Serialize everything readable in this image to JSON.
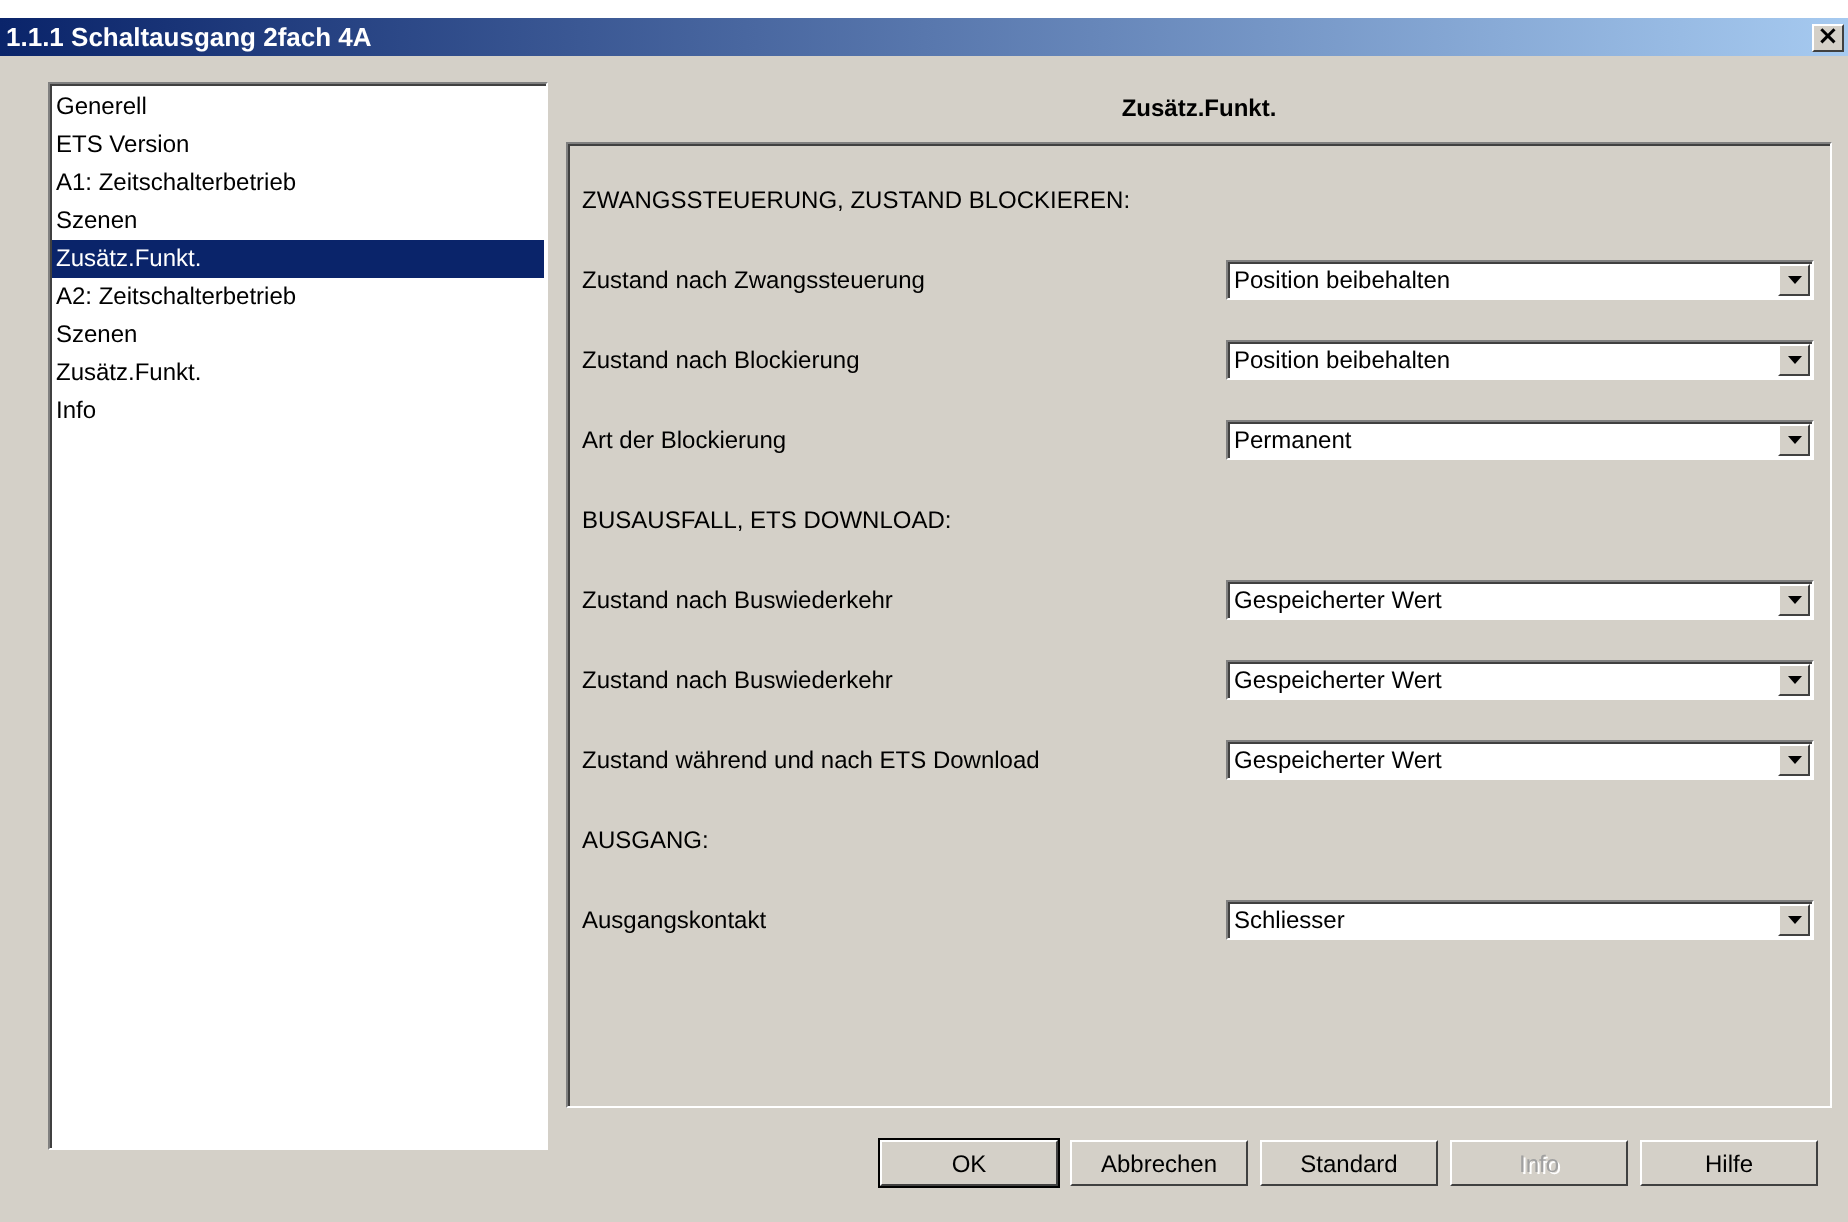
{
  "window": {
    "title": "1.1.1 Schaltausgang 2fach 4A",
    "close": "×"
  },
  "sidebar": {
    "items": [
      {
        "label": "Generell",
        "selected": false
      },
      {
        "label": "ETS Version",
        "selected": false
      },
      {
        "label": "A1: Zeitschalterbetrieb",
        "selected": false
      },
      {
        "label": "Szenen",
        "selected": false
      },
      {
        "label": "Zusätz.Funkt.",
        "selected": true
      },
      {
        "label": "A2: Zeitschalterbetrieb",
        "selected": false
      },
      {
        "label": "Szenen",
        "selected": false
      },
      {
        "label": "Zusätz.Funkt.",
        "selected": false
      },
      {
        "label": "Info",
        "selected": false
      }
    ]
  },
  "panel": {
    "title": "Zusätz.Funkt.",
    "items": [
      {
        "kind": "section",
        "label": "ZWANGSSTEUERUNG, ZUSTAND BLOCKIEREN:"
      },
      {
        "kind": "select",
        "label": "Zustand nach Zwangssteuerung",
        "value": "Position beibehalten"
      },
      {
        "kind": "select",
        "label": "Zustand nach Blockierung",
        "value": "Position beibehalten"
      },
      {
        "kind": "select",
        "label": "Art der Blockierung",
        "value": "Permanent"
      },
      {
        "kind": "section",
        "label": "BUSAUSFALL, ETS DOWNLOAD:"
      },
      {
        "kind": "select",
        "label": "Zustand nach Buswiederkehr",
        "value": "Gespeicherter Wert"
      },
      {
        "kind": "select",
        "label": "Zustand nach Buswiederkehr",
        "value": "Gespeicherter Wert"
      },
      {
        "kind": "select",
        "label": "Zustand während und nach ETS Download",
        "value": "Gespeicherter Wert"
      },
      {
        "kind": "section",
        "label": "AUSGANG:"
      },
      {
        "kind": "select",
        "label": "Ausgangskontakt",
        "value": "Schliesser"
      }
    ]
  },
  "buttons": [
    {
      "label": "OK",
      "disabled": false,
      "default": true
    },
    {
      "label": "Abbrechen",
      "disabled": false,
      "default": false
    },
    {
      "label": "Standard",
      "disabled": false,
      "default": false
    },
    {
      "label": "Info",
      "disabled": true,
      "default": false
    },
    {
      "label": "Hilfe",
      "disabled": false,
      "default": false
    }
  ]
}
